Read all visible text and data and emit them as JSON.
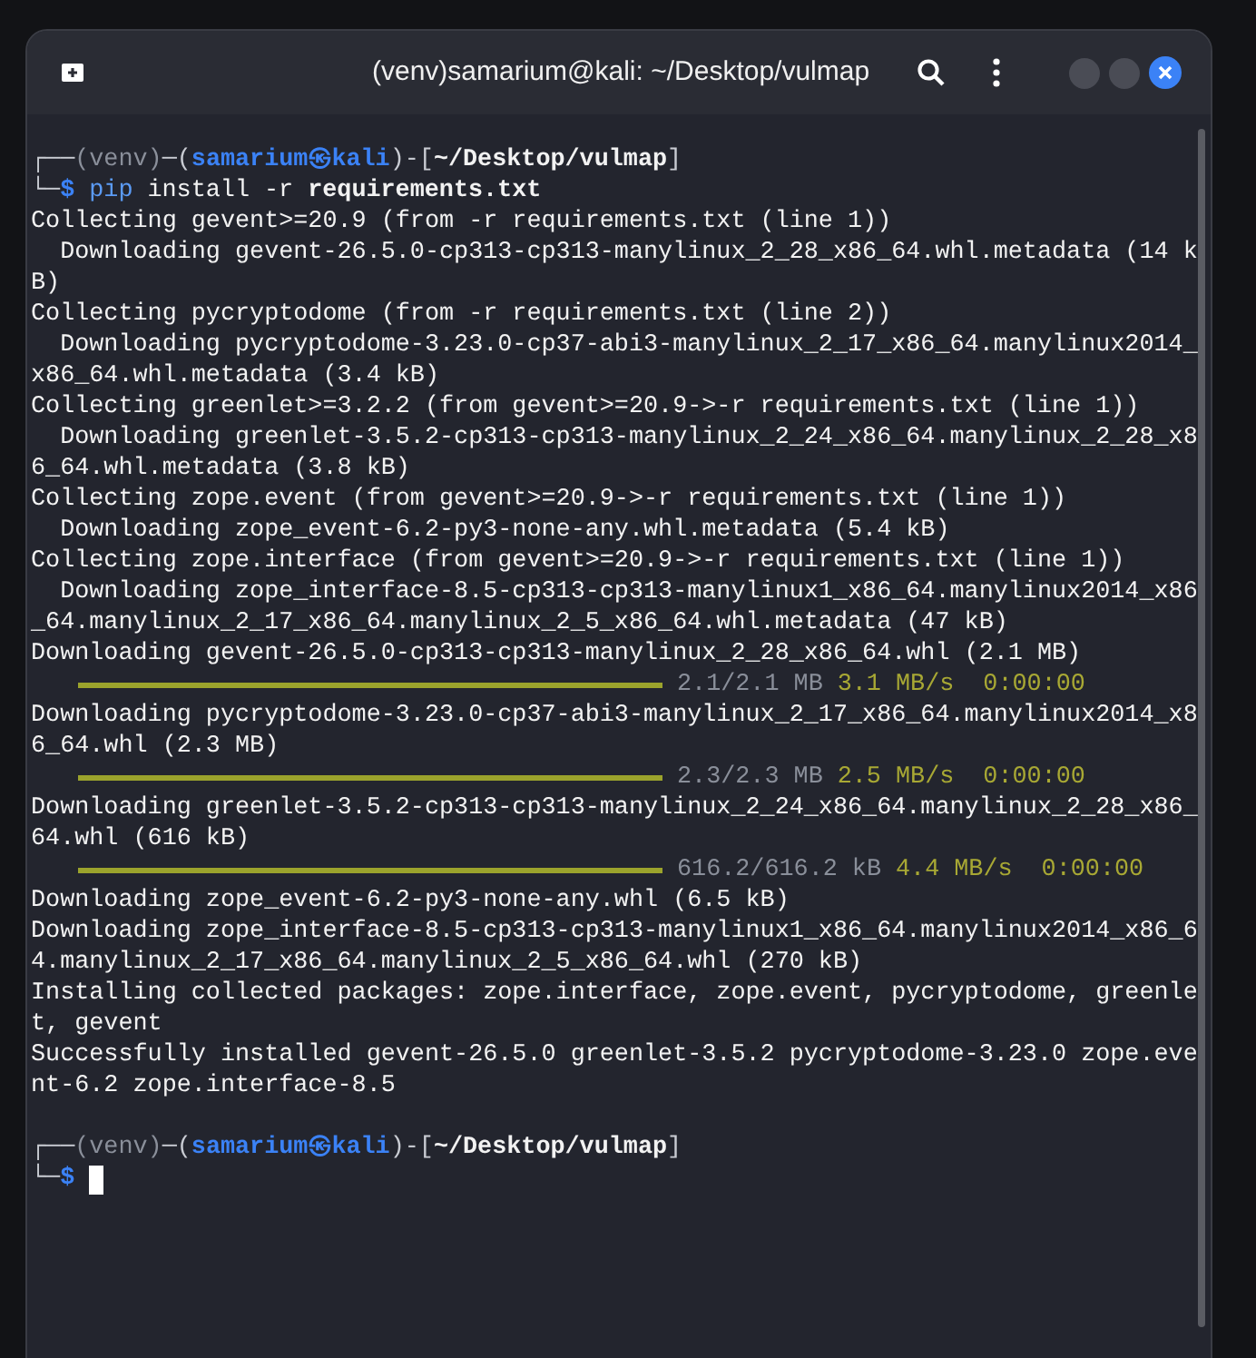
{
  "window": {
    "title": "(venv)samarium@kali: ~/Desktop/vulmap"
  },
  "terminal": {
    "lines": [
      {
        "kind": "prompt",
        "segments": [
          {
            "text": "┌──",
            "kind": "frame"
          },
          {
            "text": "(venv)",
            "kind": "venv"
          },
          {
            "text": "─(",
            "kind": "frame"
          },
          {
            "text": "samarium㉿kali",
            "kind": "user"
          },
          {
            "text": ")-[",
            "kind": "frame"
          },
          {
            "text": "~/Desktop/vulmap",
            "kind": "path"
          },
          {
            "text": "]",
            "kind": "frame"
          }
        ]
      },
      {
        "kind": "prompt",
        "segments": [
          {
            "text": "└─",
            "kind": "frame"
          },
          {
            "text": "$",
            "kind": "user"
          },
          {
            "text": "pip",
            "kind": "program"
          },
          {
            "text": "install -r",
            "kind": "arg"
          },
          {
            "text": "requirements.txt",
            "kind": "file"
          }
        ]
      },
      {
        "kind": "text",
        "text": "Collecting gevent>=20.9 (from -r requirements.txt (line 1))"
      },
      {
        "kind": "text",
        "text": "  Downloading gevent-26.5.0-cp313-cp313-manylinux_2_28_x86_64.whl.metadata (14 k"
      },
      {
        "kind": "text",
        "text": "B)"
      },
      {
        "kind": "text",
        "text": "Collecting pycryptodome (from -r requirements.txt (line 2))"
      },
      {
        "kind": "text",
        "text": "  Downloading pycryptodome-3.23.0-cp37-abi3-manylinux_2_17_x86_64.manylinux2014_"
      },
      {
        "kind": "text",
        "text": "x86_64.whl.metadata (3.4 kB)"
      },
      {
        "kind": "text",
        "text": "Collecting greenlet>=3.2.2 (from gevent>=20.9->-r requirements.txt (line 1))"
      },
      {
        "kind": "text",
        "text": "  Downloading greenlet-3.5.2-cp313-cp313-manylinux_2_24_x86_64.manylinux_2_28_x8"
      },
      {
        "kind": "text",
        "text": "6_64.whl.metadata (3.8 kB)"
      },
      {
        "kind": "text",
        "text": "Collecting zope.event (from gevent>=20.9->-r requirements.txt (line 1))"
      },
      {
        "kind": "text",
        "text": "  Downloading zope_event-6.2-py3-none-any.whl.metadata (5.4 kB)"
      },
      {
        "kind": "text",
        "text": "Collecting zope.interface (from gevent>=20.9->-r requirements.txt (line 1))"
      },
      {
        "kind": "text",
        "text": "  Downloading zope_interface-8.5-cp313-cp313-manylinux1_x86_64.manylinux2014_x86"
      },
      {
        "kind": "text",
        "text": "_64.manylinux_2_17_x86_64.manylinux_2_5_x86_64.whl.metadata (47 kB)"
      },
      {
        "kind": "text",
        "text": "Downloading gevent-26.5.0-cp313-cp313-manylinux_2_28_x86_64.whl (2.1 MB)"
      },
      {
        "kind": "progress",
        "level": 1,
        "size": "2.1/2.1 MB",
        "speed": "3.1 MB/s",
        "eta": "0:00:00"
      },
      {
        "kind": "text",
        "text": "Downloading pycryptodome-3.23.0-cp37-abi3-manylinux_2_17_x86_64.manylinux2014_x8"
      },
      {
        "kind": "text",
        "text": "6_64.whl (2.3 MB)"
      },
      {
        "kind": "progress",
        "level": 1,
        "size": "2.3/2.3 MB",
        "speed": "2.5 MB/s",
        "eta": "0:00:00"
      },
      {
        "kind": "text",
        "text": "Downloading greenlet-3.5.2-cp313-cp313-manylinux_2_24_x86_64.manylinux_2_28_x86_"
      },
      {
        "kind": "text",
        "text": "64.whl (616 kB)"
      },
      {
        "kind": "progress",
        "level": 1,
        "size": "616.2/616.2 kB",
        "speed": "4.4 MB/s",
        "eta": "0:00:00"
      },
      {
        "kind": "text",
        "text": "Downloading zope_event-6.2-py3-none-any.whl (6.5 kB)"
      },
      {
        "kind": "text",
        "text": "Downloading zope_interface-8.5-cp313-cp313-manylinux1_x86_64.manylinux2014_x86_6"
      },
      {
        "kind": "text",
        "text": "4.manylinux_2_17_x86_64.manylinux_2_5_x86_64.whl (270 kB)"
      },
      {
        "kind": "text",
        "text": "Installing collected packages: zope.interface, zope.event, pycryptodome, greenle"
      },
      {
        "kind": "text",
        "text": "t, gevent"
      },
      {
        "kind": "text",
        "text": "Successfully installed gevent-26.5.0 greenlet-3.5.2 pycryptodome-3.23.0 zope.eve"
      },
      {
        "kind": "text",
        "text": "nt-6.2 zope.interface-8.5"
      },
      {
        "kind": "blank"
      },
      {
        "kind": "prompt",
        "segments": [
          {
            "text": "┌──",
            "kind": "frame"
          },
          {
            "text": "(venv)",
            "kind": "venv"
          },
          {
            "text": "─(",
            "kind": "frame"
          },
          {
            "text": "samarium㉿kali",
            "kind": "user"
          },
          {
            "text": ")-[",
            "kind": "frame"
          },
          {
            "text": "~/Desktop/vulmap",
            "kind": "path"
          },
          {
            "text": "]",
            "kind": "frame"
          }
        ]
      },
      {
        "kind": "prompt",
        "cursor": true,
        "segments": [
          {
            "text": "└─",
            "kind": "frame"
          },
          {
            "text": "$",
            "kind": "user"
          }
        ]
      }
    ]
  }
}
